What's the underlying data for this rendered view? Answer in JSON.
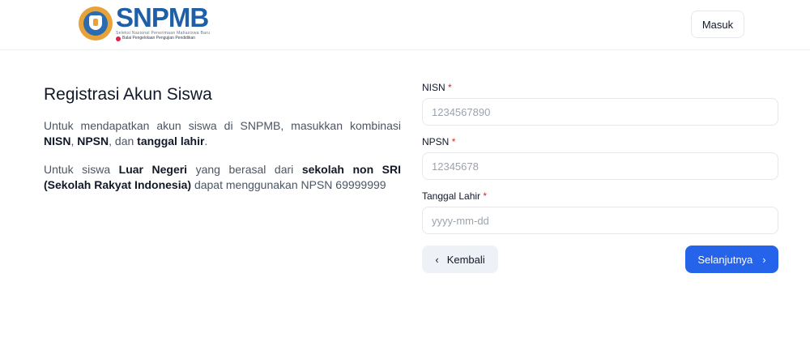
{
  "header": {
    "logo": {
      "word": "SNPMB",
      "subtitle_line1": "Seleksi Nasional Penerimaan Mahasiswa Baru",
      "subtitle_line2": "Balai Pengelolaan Pengujian Pendidikan"
    },
    "login_label": "Masuk"
  },
  "intro": {
    "title": "Registrasi Akun Siswa",
    "p1": {
      "text_a": "Untuk mendapatkan akun siswa di SNPMB, masukkan kombinasi ",
      "bold_nisn": "NISN",
      "sep1": ", ",
      "bold_npsn": "NPSN",
      "sep2": ", dan ",
      "bold_dob": "tanggal lahir",
      "end": "."
    },
    "p2": {
      "text_a": "Untuk siswa ",
      "bold_ln": "Luar Negeri",
      "text_b": " yang berasal dari ",
      "bold_sri": "sekolah non SRI (Sekolah Rakyat Indonesia)",
      "text_c": " dapat menggunakan NPSN 69999999"
    }
  },
  "form": {
    "nisn": {
      "label": "NISN",
      "required": "*",
      "placeholder": "1234567890"
    },
    "npsn": {
      "label": "NPSN",
      "required": "*",
      "placeholder": "12345678"
    },
    "dob": {
      "label": "Tanggal Lahir",
      "required": "*",
      "placeholder": "yyyy-mm-dd"
    },
    "back_label": "Kembali",
    "next_label": "Selanjutnya",
    "back_icon": "‹",
    "next_icon": "›"
  },
  "colors": {
    "primary": "#2563eb",
    "required": "#dc2626",
    "brand": "#1f5fa8"
  }
}
